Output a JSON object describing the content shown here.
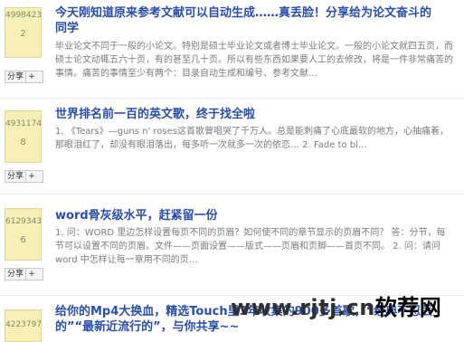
{
  "items": [
    {
      "count1": "4998423",
      "count2": "2",
      "title_line1": "今天刚知道原来参考文献可以自动生成……真丢脸！分享给为论文奋斗的",
      "title_line2": "同学",
      "desc": "毕业论文不同于一般的小论文。特别是硕士毕业论文或者博士毕业论文。一般的小论文就四五页，而硕士论文动辄五六十页，有的甚至几十页。所以有些东西如果要人工的去修改，将是一件非常痛苦的事情。痛苦的事情至少有两个：目录自动生成和编号、参考文献…",
      "share_label": "分享",
      "plus_label": "+"
    },
    {
      "count1": "4931174",
      "count2": "8",
      "title": "世界排名前一百的英文歌，终于找全啦",
      "desc": "1. 《Tears》—guns n' roses这首歌曾唱哭了千万人。总是能刺痛了心底最软的地方，心抽痛着，那眼泪红了，却没有眼泪落出，每多听一次就多一次的依恋… 2. Fade to bl…",
      "share_label": "分享",
      "plus_label": "+"
    },
    {
      "count1": "6129343",
      "count2": "6",
      "title": "word骨灰级水平，赶紧留一份",
      "desc": "1. 问：WORD 里边怎样设置每页不同的页眉？如何使不同的章节显示的页眉不同？ 答：分节，每节可以设置不同的页眉。文件——页面设置——版式——页眉和页脚——首页不同。 2. 问：请问word 中怎样让每一章用不同的页…",
      "share_label": "分享",
      "plus_label": "+"
    },
    {
      "count1": "4223797",
      "title_line1": "给你的Mp4大换血，精选Touch里3年收集的900多首歌，“经典不忍丢",
      "title_line2": "的”“最新近流行的”，与你共享~~"
    }
  ],
  "watermark": {
    "site": "www.rjtj.cn",
    "slogan": "软荐网"
  }
}
